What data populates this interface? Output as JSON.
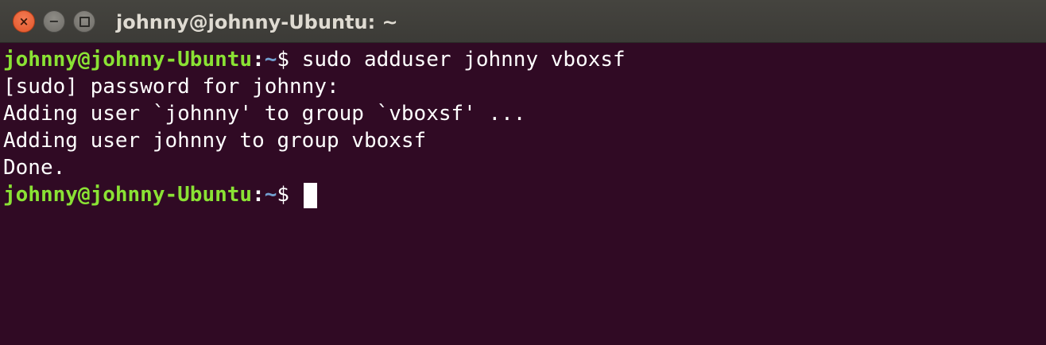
{
  "window": {
    "title": "johnny@johnny-Ubuntu: ~",
    "buttons": {
      "close_glyph": "×",
      "minimize_glyph": "−"
    }
  },
  "colors": {
    "terminal_background": "#300a24",
    "prompt_user": "#8ae234",
    "prompt_path": "#729fcf",
    "text": "#ffffff"
  },
  "terminal": {
    "prompt1": {
      "user_host": "johnny@johnny-Ubuntu",
      "colon": ":",
      "path": "~",
      "dollar": "$ ",
      "command": "sudo adduser johnny vboxsf"
    },
    "output": [
      "[sudo] password for johnny:",
      "Adding user `johnny' to group `vboxsf' ...",
      "Adding user johnny to group vboxsf",
      "Done."
    ],
    "prompt2": {
      "user_host": "johnny@johnny-Ubuntu",
      "colon": ":",
      "path": "~",
      "dollar": "$ "
    }
  }
}
